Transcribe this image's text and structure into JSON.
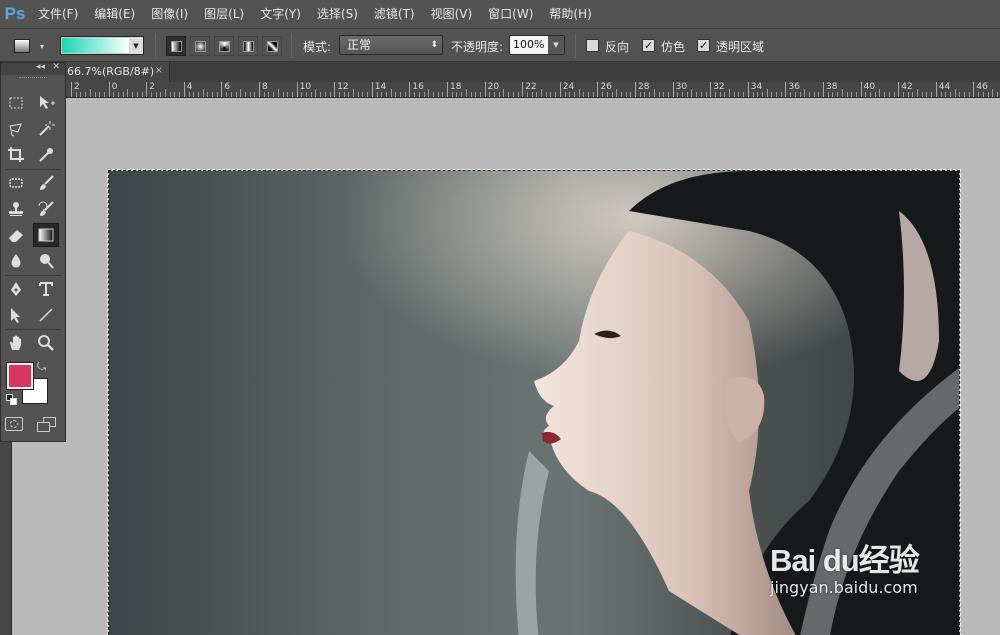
{
  "app": {
    "logo": "Ps",
    "menu": [
      "文件(F)",
      "编辑(E)",
      "图像(I)",
      "图层(L)",
      "文字(Y)",
      "选择(S)",
      "滤镜(T)",
      "视图(V)",
      "窗口(W)",
      "帮助(H)"
    ]
  },
  "options": {
    "gradient_colors": [
      "#19d6b1",
      "#ffffff"
    ],
    "mode_label": "模式:",
    "mode_value": "正常",
    "opacity_label": "不透明度:",
    "opacity_value": "100%",
    "reverse_label": "反向",
    "reverse_checked": false,
    "dither_label": "仿色",
    "dither_checked": true,
    "transparency_label": "透明区域",
    "transparency_checked": true
  },
  "document": {
    "tab_title": "66.7%(RGB/8#)",
    "close_glyph": "×"
  },
  "ruler": {
    "ticks": [
      "2",
      "0",
      "2",
      "4",
      "6",
      "8",
      "10",
      "12",
      "14",
      "16",
      "18",
      "20",
      "22",
      "24",
      "26",
      "28",
      "30",
      "32",
      "34",
      "36",
      "38",
      "40",
      "42",
      "44",
      "46"
    ]
  },
  "tools": {
    "collapse_glyph": "◂◂",
    "close_glyph": "✕",
    "foreground_color": "#d6365f",
    "background_color": "#ffffff",
    "selected": "gradient-tool"
  },
  "watermark": {
    "main": "Bai du经验",
    "sub": "jingyan.baidu.com"
  }
}
